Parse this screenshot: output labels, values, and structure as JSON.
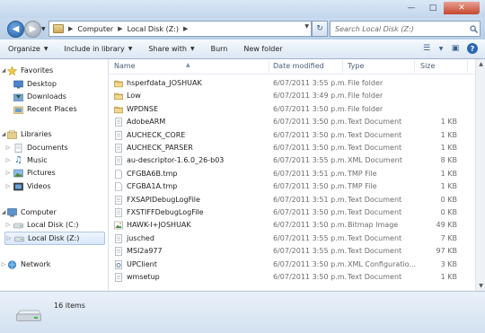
{
  "titlebar": {
    "minimize_icon": "minimize-icon",
    "maximize_icon": "maximize-icon",
    "close_icon": "close-icon"
  },
  "address": {
    "crumbs": [
      "Computer",
      "Local Disk (Z:)"
    ],
    "search_placeholder": "Search Local Disk (Z:)"
  },
  "toolbar": {
    "organize": "Organize",
    "include": "Include in library",
    "share": "Share with",
    "burn": "Burn",
    "new_folder": "New folder"
  },
  "nav": {
    "favorites": "Favorites",
    "desktop": "Desktop",
    "downloads": "Downloads",
    "recent": "Recent Places",
    "libraries": "Libraries",
    "documents": "Documents",
    "music": "Music",
    "pictures": "Pictures",
    "videos": "Videos",
    "computer": "Computer",
    "disk_c": "Local Disk (C:)",
    "disk_z": "Local Disk (Z:)",
    "network": "Network"
  },
  "columns": {
    "name": "Name",
    "date": "Date modified",
    "type": "Type",
    "size": "Size"
  },
  "files": [
    {
      "name": "hsperfdata_JOSHUAK",
      "date": "6/07/2011 3:55 p.m.",
      "type": "File folder",
      "size": "",
      "icon": "folder"
    },
    {
      "name": "Low",
      "date": "6/07/2011 3:49 p.m.",
      "type": "File folder",
      "size": "",
      "icon": "folder"
    },
    {
      "name": "WPDNSE",
      "date": "6/07/2011 3:50 p.m.",
      "type": "File folder",
      "size": "",
      "icon": "folder"
    },
    {
      "name": "AdobeARM",
      "date": "6/07/2011 3:50 p.m.",
      "type": "Text Document",
      "size": "1 KB",
      "icon": "text"
    },
    {
      "name": "AUCHECK_CORE",
      "date": "6/07/2011 3:50 p.m.",
      "type": "Text Document",
      "size": "1 KB",
      "icon": "text"
    },
    {
      "name": "AUCHECK_PARSER",
      "date": "6/07/2011 3:50 p.m.",
      "type": "Text Document",
      "size": "1 KB",
      "icon": "text"
    },
    {
      "name": "au-descriptor-1.6.0_26-b03",
      "date": "6/07/2011 3:55 p.m.",
      "type": "XML Document",
      "size": "8 KB",
      "icon": "text"
    },
    {
      "name": "CFGBA6B.tmp",
      "date": "6/07/2011 3:51 p.m.",
      "type": "TMP File",
      "size": "1 KB",
      "icon": "blank"
    },
    {
      "name": "CFGBA1A.tmp",
      "date": "6/07/2011 3:50 p.m.",
      "type": "TMP File",
      "size": "1 KB",
      "icon": "blank"
    },
    {
      "name": "FXSAPIDebugLogFile",
      "date": "6/07/2011 3:51 p.m.",
      "type": "Text Document",
      "size": "0 KB",
      "icon": "text"
    },
    {
      "name": "FXSTIFFDebugLogFile",
      "date": "6/07/2011 3:50 p.m.",
      "type": "Text Document",
      "size": "0 KB",
      "icon": "text"
    },
    {
      "name": "HAWK-I+JOSHUAK",
      "date": "6/07/2011 3:50 p.m.",
      "type": "Bitmap Image",
      "size": "49 KB",
      "icon": "image"
    },
    {
      "name": "jusched",
      "date": "6/07/2011 3:55 p.m.",
      "type": "Text Document",
      "size": "7 KB",
      "icon": "text"
    },
    {
      "name": "MSI2a977",
      "date": "6/07/2011 3:55 p.m.",
      "type": "Text Document",
      "size": "97 KB",
      "icon": "text"
    },
    {
      "name": "UPClient",
      "date": "6/07/2011 3:50 p.m.",
      "type": "XML Configuratio...",
      "size": "3 KB",
      "icon": "gear"
    },
    {
      "name": "wmsetup",
      "date": "6/07/2011 3:50 p.m.",
      "type": "Text Document",
      "size": "1 KB",
      "icon": "text"
    }
  ],
  "status": {
    "count": "16 items"
  }
}
